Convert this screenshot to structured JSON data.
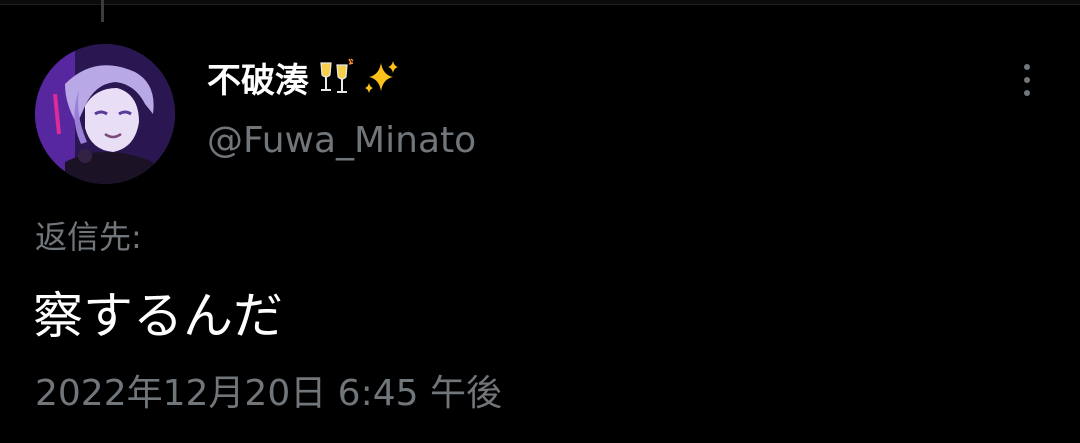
{
  "tweet": {
    "author": {
      "display_name": "不破湊",
      "name_emoji": [
        "clinking-glasses-icon",
        "sparkles-icon"
      ],
      "handle": "@Fuwa_Minato",
      "avatar": "avatar-image"
    },
    "reply_label": "返信先:",
    "text": "察するんだ",
    "timestamp": "2022年12月20日 6:45 午後"
  },
  "colors": {
    "background": "#000000",
    "primary_text": "#ffffff",
    "secondary_text": "#71767b",
    "thread_line": "#3a3d40"
  }
}
